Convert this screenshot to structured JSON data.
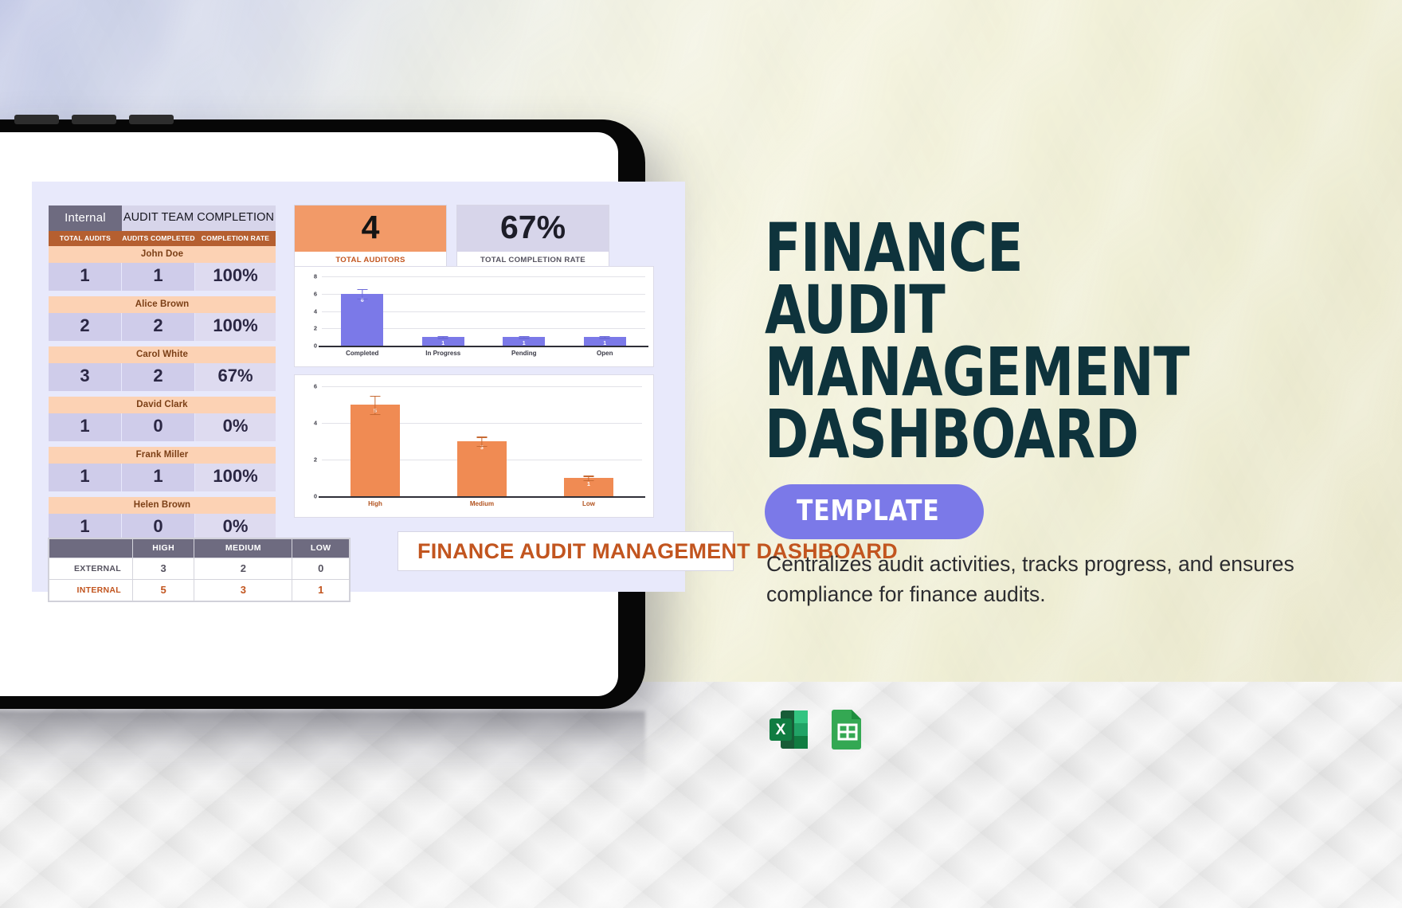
{
  "hero": {
    "title_lines": [
      "FINANCE AUDIT",
      "MANAGEMENT",
      "DASHBOARD"
    ],
    "badge_label": "TEMPLATE",
    "description": "Centralizes audit activities, tracks progress, and ensures compliance for finance audits.",
    "accent_teal": "#0e333c",
    "accent_purple": "#7b79e8"
  },
  "file_formats": [
    {
      "name": "excel-icon",
      "label": "X",
      "color": "#107c41"
    },
    {
      "name": "google-sheets-icon",
      "label": "",
      "color": "#34a853"
    }
  ],
  "dashboard": {
    "team_table": {
      "tag_label": "Internal",
      "title": "AUDIT TEAM COMPLETION",
      "columns": [
        "TOTAL AUDITS",
        "AUDITS COMPLETED",
        "COMPLETION RATE"
      ],
      "rows": [
        {
          "name": "John Doe",
          "total_audits": "1",
          "audits_completed": "1",
          "completion_rate": "100%"
        },
        {
          "name": "Alice Brown",
          "total_audits": "2",
          "audits_completed": "2",
          "completion_rate": "100%"
        },
        {
          "name": "Carol White",
          "total_audits": "3",
          "audits_completed": "2",
          "completion_rate": "67%"
        },
        {
          "name": "David Clark",
          "total_audits": "1",
          "audits_completed": "0",
          "completion_rate": "0%"
        },
        {
          "name": "Frank Miller",
          "total_audits": "1",
          "audits_completed": "1",
          "completion_rate": "100%"
        },
        {
          "name": "Helen Brown",
          "total_audits": "1",
          "audits_completed": "0",
          "completion_rate": "0%"
        }
      ]
    },
    "severity_table": {
      "columns": [
        "",
        "HIGH",
        "MEDIUM",
        "LOW"
      ],
      "rows": [
        {
          "label": "EXTERNAL",
          "high": "3",
          "medium": "2",
          "low": "0"
        },
        {
          "label": "INTERNAL",
          "high": "5",
          "medium": "3",
          "low": "1"
        }
      ]
    },
    "kpis": [
      {
        "value": "4",
        "caption": "TOTAL AUDITORS",
        "color": "#f29a68"
      },
      {
        "value": "67%",
        "caption": "TOTAL COMPLETION RATE",
        "color": "#d7d5ea"
      }
    ],
    "footer_title": "FINANCE AUDIT MANAGEMENT DASHBOARD"
  },
  "chart_data": [
    {
      "type": "bar",
      "title": "",
      "categories": [
        "Completed",
        "In Progress",
        "Pending",
        "Open"
      ],
      "values": [
        6,
        1,
        1,
        1
      ],
      "errors": [
        0.55,
        0.12,
        0.12,
        0.12
      ],
      "ylim": [
        0,
        8
      ],
      "yticks": [
        0,
        2,
        4,
        6,
        8
      ],
      "xlabel": "",
      "ylabel": "",
      "grid": true,
      "legend": "none",
      "color": "#7b79e8"
    },
    {
      "type": "bar",
      "title": "",
      "categories": [
        "High",
        "Medium",
        "Low"
      ],
      "values": [
        5,
        3,
        1
      ],
      "errors": [
        0.5,
        0.25,
        0.12
      ],
      "ylim": [
        0,
        6
      ],
      "yticks": [
        0,
        2,
        4,
        6
      ],
      "xlabel": "",
      "ylabel": "",
      "grid": true,
      "legend": "none",
      "color": "#f08b53"
    }
  ]
}
